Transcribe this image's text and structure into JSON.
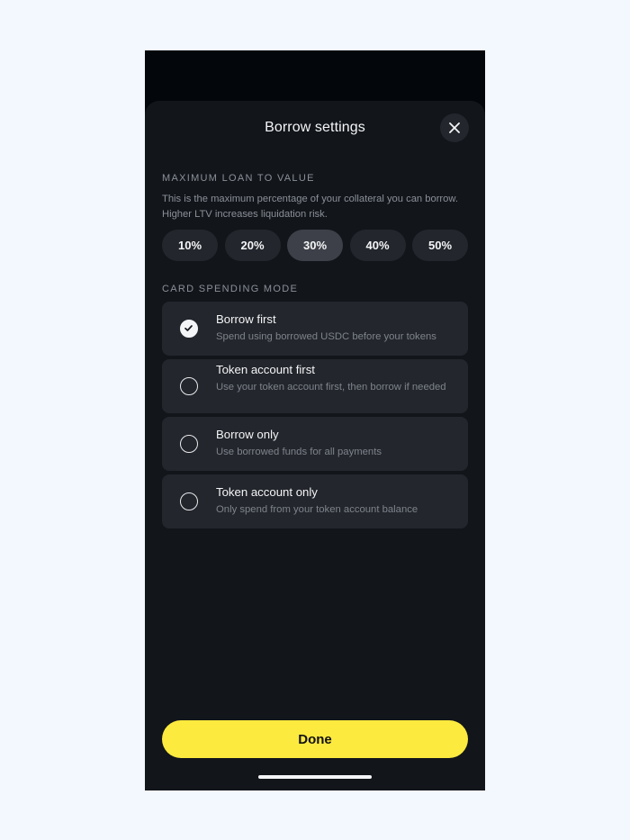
{
  "sheet": {
    "title": "Borrow settings",
    "close_icon": "close-icon"
  },
  "ltv": {
    "label": "MAXIMUM LOAN TO VALUE",
    "description": "This is the maximum percentage of your collateral you can borrow. Higher LTV increases liquidation risk.",
    "options": [
      "10%",
      "20%",
      "30%",
      "40%",
      "50%"
    ],
    "selected": "30%"
  },
  "spending": {
    "label": "CARD SPENDING MODE",
    "modes": [
      {
        "title": "Borrow first",
        "description": "Spend using borrowed USDC before your tokens",
        "checked": true
      },
      {
        "title": "Token account first",
        "description": "Use your token account first, then borrow if needed",
        "checked": false
      },
      {
        "title": "Borrow only",
        "description": "Use borrowed funds for all payments",
        "checked": false
      },
      {
        "title": "Token account only",
        "description": "Only spend from your token account balance",
        "checked": false
      }
    ]
  },
  "footer": {
    "done_label": "Done"
  },
  "colors": {
    "accent": "#fdea3f",
    "sheet_bg": "#12151a",
    "card_bg": "#23262c",
    "selected_pill": "#3d4048"
  }
}
